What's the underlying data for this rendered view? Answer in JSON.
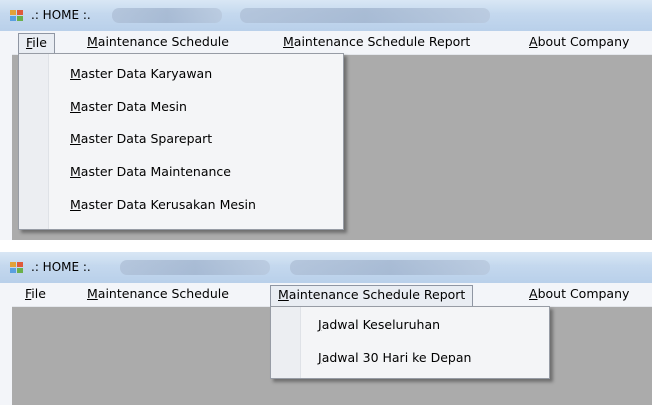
{
  "screenshots": [
    {
      "title": ".: HOME :.",
      "menu": [
        {
          "key": "F",
          "rest": "ile"
        },
        {
          "key": "M",
          "rest": "aintenance Schedule"
        },
        {
          "key": "M",
          "rest": "aintenance Schedule Report"
        },
        {
          "key": "A",
          "rest": "bout Company"
        }
      ],
      "open_menu": "File",
      "dropdown_items": [
        {
          "key": "M",
          "rest": "aster Data Karyawan"
        },
        {
          "key": "M",
          "rest": "aster Data Mesin"
        },
        {
          "key": "M",
          "rest": "aster Data Sparepart"
        },
        {
          "key": "M",
          "rest": "aster Data Maintenance"
        },
        {
          "key": "M",
          "rest": "aster Data Kerusakan Mesin"
        }
      ]
    },
    {
      "title": ".: HOME :.",
      "menu": [
        {
          "key": "F",
          "rest": "ile"
        },
        {
          "key": "M",
          "rest": "aintenance Schedule"
        },
        {
          "key": "M",
          "rest": "aintenance Schedule Report"
        },
        {
          "key": "A",
          "rest": "bout Company"
        }
      ],
      "open_menu": "Maintenance Schedule Report",
      "dropdown_items": [
        {
          "key": "J",
          "rest": "adwal Keseluruhan"
        },
        {
          "key": "J",
          "rest": "adwal 30 Hari ke Depan"
        }
      ]
    }
  ],
  "colors": {
    "titlebar": "#c4d8ee",
    "menubar": "#f3f5f9",
    "client_area": "#ababab",
    "dropdown": "#f4f5f7"
  },
  "icons": {
    "window_icon": "app-window-icon"
  }
}
